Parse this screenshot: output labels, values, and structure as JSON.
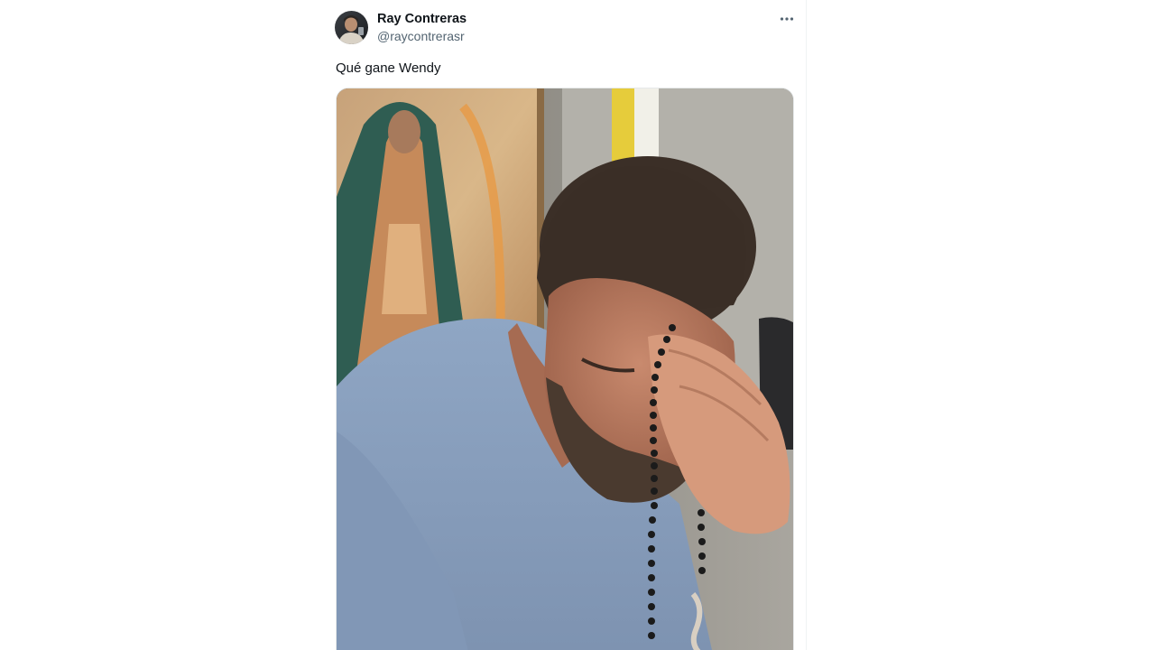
{
  "tweet": {
    "author": {
      "display_name": "Ray Contreras",
      "handle": "@raycontrerasr"
    },
    "text": "Qué gane Wendy",
    "more_icon": "more-horizontal-icon",
    "media": {
      "kind": "photo",
      "avatar_icon": "profile-avatar"
    }
  },
  "colors": {
    "text_primary": "#0f1419",
    "text_secondary": "#536471",
    "border": "#eff3f4"
  }
}
